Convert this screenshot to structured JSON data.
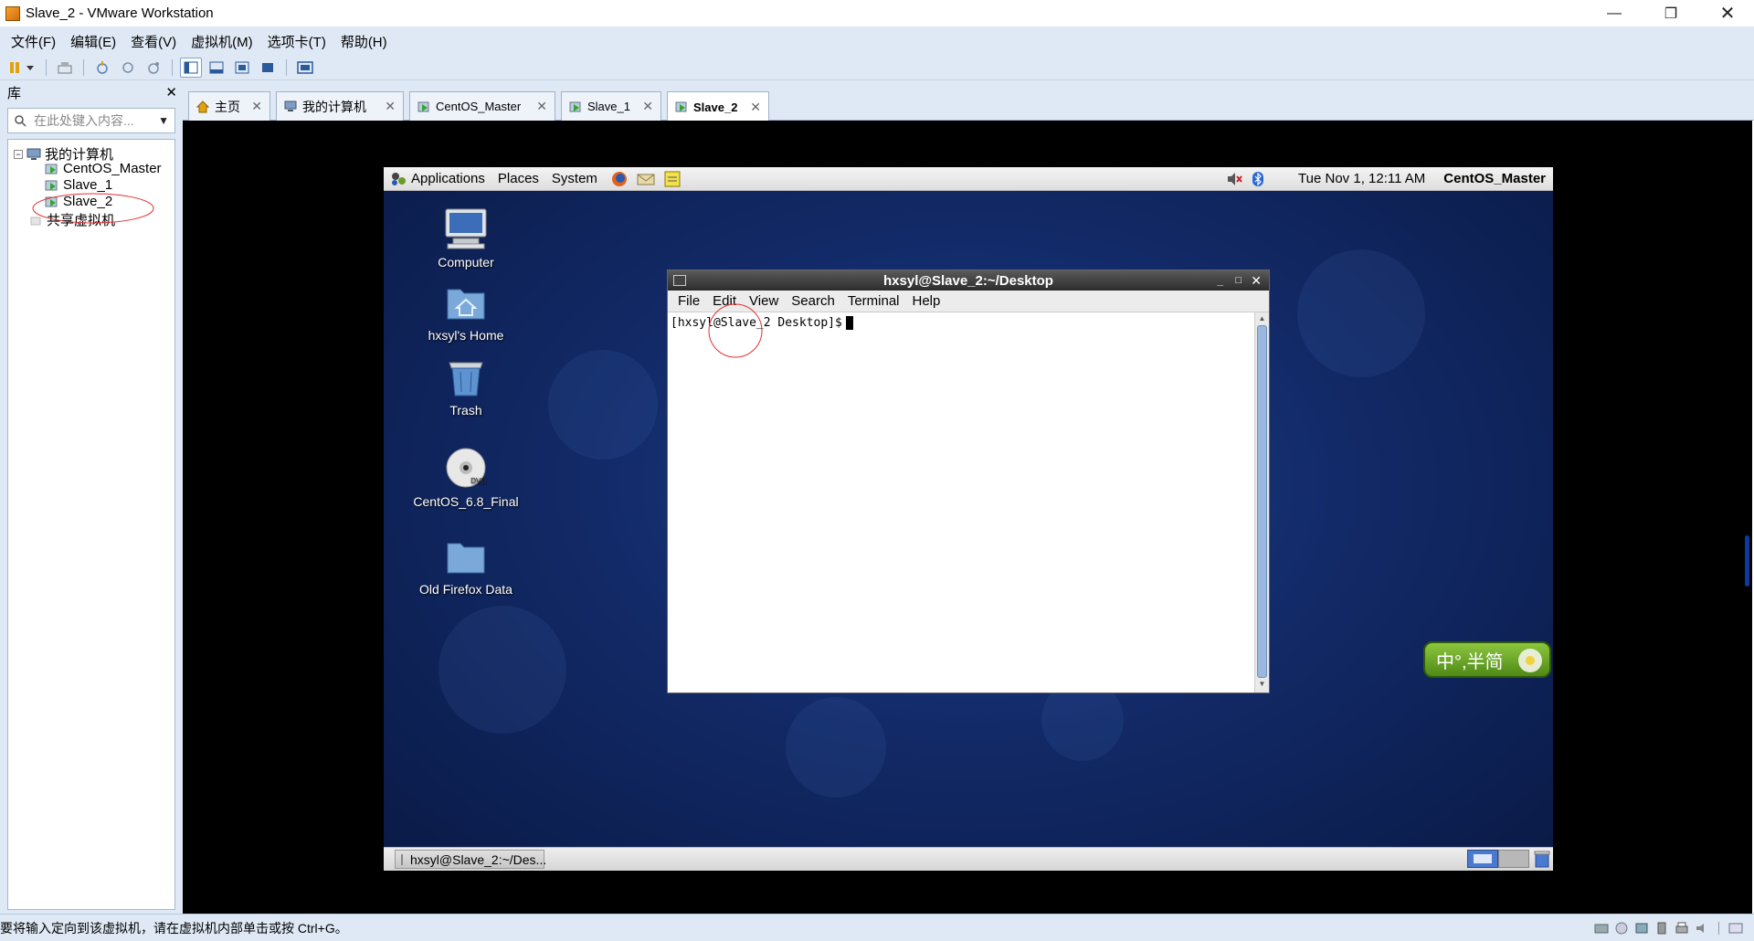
{
  "window": {
    "title": "Slave_2 - VMware Workstation"
  },
  "menubar": [
    "文件(F)",
    "编辑(E)",
    "查看(V)",
    "虚拟机(M)",
    "选项卡(T)",
    "帮助(H)"
  ],
  "library": {
    "title": "库",
    "search_placeholder": "在此处键入内容...",
    "tree": [
      {
        "label": "我的计算机",
        "level": 0
      },
      {
        "label": "CentOS_Master",
        "level": 1
      },
      {
        "label": "Slave_1",
        "level": 1
      },
      {
        "label": "Slave_2",
        "level": 1,
        "selected": true
      },
      {
        "label": "共享虚拟机",
        "level": 0
      }
    ]
  },
  "tabs": [
    {
      "label": "主页",
      "active": false
    },
    {
      "label": "我的计算机",
      "active": false
    },
    {
      "label": "CentOS_Master",
      "active": false
    },
    {
      "label": "Slave_1",
      "active": false
    },
    {
      "label": "Slave_2",
      "active": true
    }
  ],
  "guest": {
    "panel": {
      "applications": "Applications",
      "places": "Places",
      "system": "System",
      "datetime": "Tue Nov  1, 12:11 AM",
      "hostname": "CentOS_Master"
    },
    "desktop_icons": [
      {
        "label": "Computer",
        "icon": "computer-icon"
      },
      {
        "label": "hxsyl's Home",
        "icon": "home-folder-icon"
      },
      {
        "label": "Trash",
        "icon": "trash-icon"
      },
      {
        "label": "CentOS_6.8_Final",
        "icon": "dvd-icon"
      },
      {
        "label": "Old Firefox Data",
        "icon": "folder-icon"
      }
    ],
    "terminal": {
      "title": "hxsyl@Slave_2:~/Desktop",
      "menu": [
        "File",
        "Edit",
        "View",
        "Search",
        "Terminal",
        "Help"
      ],
      "prompt": "[hxsyl@Slave_2 Desktop]$"
    },
    "taskbar_item": "hxsyl@Slave_2:~/Des...",
    "ime": "中°,半简"
  },
  "statusbar": {
    "text": "要将输入定向到该虚拟机，请在虚拟机内部单击或按 Ctrl+G。"
  },
  "colors": {
    "chrome": "#dfe9f5",
    "guest_bg": "#122a68",
    "annotation": "#e03030"
  }
}
